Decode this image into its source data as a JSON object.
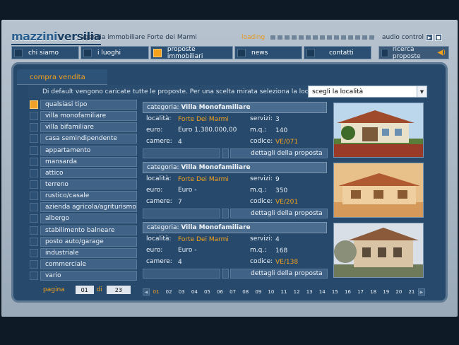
{
  "header": {
    "logo_main": "mazzini",
    "logo_accent": "versilia",
    "tagline": "agenzia immobiliare Forte dei Marmi",
    "loading_label": "loading",
    "audio_label": "audio control",
    "audio_play_icon": "play-icon",
    "audio_stop_icon": "stop-icon"
  },
  "nav": {
    "items": [
      {
        "label": "chi siamo"
      },
      {
        "label": "i luoghi"
      },
      {
        "label": "proposte immobiliari"
      },
      {
        "label": "news"
      },
      {
        "label": "contatti"
      }
    ],
    "search_label": "ricerca proposte",
    "speaker_icon": "speaker-icon"
  },
  "panel": {
    "tab_title": "compra vendita",
    "info_text": "Di default vengono caricate tutte le proposte. Per una scelta mirata seleziona la località",
    "location_select": "scegli la località"
  },
  "types": [
    "qualsiasi tipo",
    "villa monofamiliare",
    "villa bifamiliare",
    "casa semindipendente",
    "appartamento",
    "mansarda",
    "attico",
    "terreno",
    "rustico/casale",
    "azienda agricola/agriturismo",
    "albergo",
    "stabilimento balneare",
    "posto auto/garage",
    "industriale",
    "commerciale",
    "vario"
  ],
  "pager": {
    "label": "pagina",
    "current": "01",
    "of": "di",
    "total": "23"
  },
  "labels": {
    "category": "categoria:",
    "location": "località:",
    "price": "euro:",
    "rooms": "camere:",
    "services": "servizi:",
    "sqm": "m.q.:",
    "code": "codice:",
    "details": "dettagli della proposta"
  },
  "listings": [
    {
      "category": "Villa Monofamiliare",
      "location": "Forte Dei Marmi",
      "price": "Euro 1.380.000,00",
      "rooms": "4",
      "services": "3",
      "sqm": "140",
      "code": "VE/071"
    },
    {
      "category": "Villa Monofamiliare",
      "location": "Forte Dei Marmi",
      "price": "Euro -",
      "rooms": "7",
      "services": "9",
      "sqm": "350",
      "code": "VE/201"
    },
    {
      "category": "Villa Monofamiliare",
      "location": "Forte Dei Marmi",
      "price": "Euro -",
      "rooms": "4",
      "services": "4",
      "sqm": "168",
      "code": "VE/138"
    }
  ],
  "page_numbers": [
    "01",
    "02",
    "03",
    "04",
    "05",
    "06",
    "07",
    "08",
    "09",
    "10",
    "11",
    "12",
    "13",
    "14",
    "15",
    "16",
    "17",
    "18",
    "19",
    "20",
    "21"
  ]
}
